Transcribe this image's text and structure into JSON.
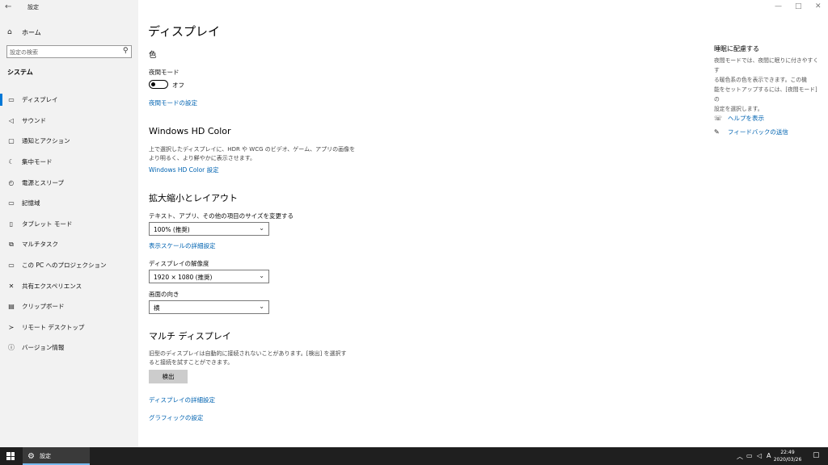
{
  "window": {
    "title": "設定",
    "back_icon": "back-arrow-icon",
    "controls": {
      "minimize": "—",
      "maximize": "□",
      "close": "✕"
    }
  },
  "sidebar": {
    "home_label": "ホーム",
    "search_placeholder": "設定の検索",
    "section_title": "システム",
    "items": [
      {
        "label": "ディスプレイ",
        "icon": "monitor-icon",
        "glyph": "▭",
        "active": true
      },
      {
        "label": "サウンド",
        "icon": "speaker-icon",
        "glyph": "🔈"
      },
      {
        "label": "通知とアクション",
        "icon": "notification-icon",
        "glyph": "▢"
      },
      {
        "label": "集中モード",
        "icon": "moon-icon",
        "glyph": "☾"
      },
      {
        "label": "電源とスリープ",
        "icon": "power-icon",
        "glyph": "⏻"
      },
      {
        "label": "記憶域",
        "icon": "storage-icon",
        "glyph": "▭"
      },
      {
        "label": "タブレット モード",
        "icon": "tablet-icon",
        "glyph": "▯"
      },
      {
        "label": "マルチタスク",
        "icon": "multitask-icon",
        "glyph": "⧉"
      },
      {
        "label": "この PC へのプロジェクション",
        "icon": "projection-icon",
        "glyph": "▭"
      },
      {
        "label": "共有エクスペリエンス",
        "icon": "share-icon",
        "glyph": "✕"
      },
      {
        "label": "クリップボード",
        "icon": "clipboard-icon",
        "glyph": "📋"
      },
      {
        "label": "リモート デスクトップ",
        "icon": "remote-icon",
        "glyph": "≻"
      },
      {
        "label": "バージョン情報",
        "icon": "info-icon",
        "glyph": "ⓘ"
      }
    ]
  },
  "main": {
    "title": "ディスプレイ",
    "color": {
      "heading": "色",
      "night_label": "夜間モード",
      "toggle_state": "オフ",
      "night_settings_link": "夜間モードの設定"
    },
    "hdr": {
      "heading": "Windows HD Color",
      "desc_line1": "上で選択したディスプレイに、HDR や WCG のビデオ、ゲーム、アプリの画像を",
      "desc_line2": "より明るく、より鮮やかに表示させます。",
      "link": "Windows HD Color 設定"
    },
    "scale": {
      "heading": "拡大縮小とレイアウト",
      "size_label": "テキスト、アプリ、その他の項目のサイズを変更する",
      "size_value": "100% (推奨)",
      "advanced_link": "表示スケールの詳細設定",
      "resolution_label": "ディスプレイの解像度",
      "resolution_value": "1920 × 1080 (推奨)",
      "orientation_label": "画面の向き",
      "orientation_value": "横"
    },
    "multi": {
      "heading": "マルチ ディスプレイ",
      "desc_line1": "旧型のディスプレイは自動的に接続されないことがあります。[検出] を選択す",
      "desc_line2": "ると接続を試すことができます。",
      "detect_button": "検出",
      "advanced_link": "ディスプレイの詳細設定",
      "graphics_link": "グラフィックの設定"
    }
  },
  "right_panel": {
    "title": "睡眠に配慮する",
    "desc_line1": "夜間モードでは、夜間に眠りに付きやすくす",
    "desc_line2": "る暖色系の色を表示できます。この機",
    "desc_line3": "能をセットアップするには、[夜間モード] の",
    "desc_line4": "設定を選択します。",
    "help_link": "ヘルプを表示",
    "feedback_link": "フィードバックの送信"
  },
  "taskbar": {
    "app_label": "設定",
    "ime": "A",
    "time": "22:49",
    "date": "2020/03/26"
  },
  "colors": {
    "accent": "#0078d7",
    "link": "#0063b1",
    "sidebar_bg": "#f2f2f2",
    "taskbar_bg": "#1f1f1f"
  }
}
